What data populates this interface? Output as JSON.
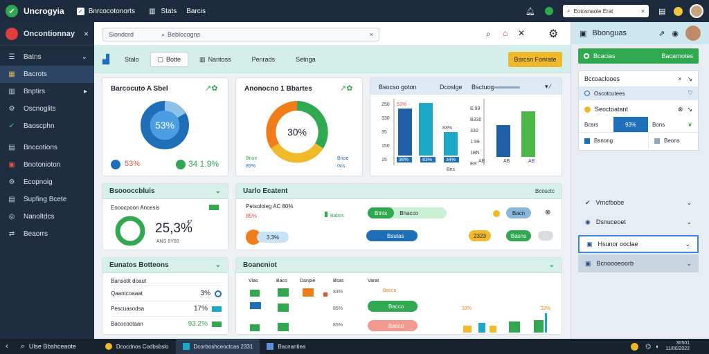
{
  "app": {
    "title": "Uncrogyia",
    "menu1": "Bnrcocotonorts",
    "menu2": "Stats",
    "menu3": "Barcis",
    "search": "Eotosnaole Erat"
  },
  "sidebar": {
    "title": "Oncontionnay",
    "items": [
      {
        "label": "Batns",
        "icon": "list-icon",
        "color": "#c6d3e0"
      },
      {
        "label": "Bacrots",
        "icon": "folder-icon",
        "color": "#e8b54a"
      },
      {
        "label": "Bnptirs",
        "icon": "building-icon",
        "color": "#c6d3e0"
      },
      {
        "label": "Oscnoglits",
        "icon": "gear-icon",
        "color": "#c6d3e0"
      },
      {
        "label": "Baoscphn",
        "icon": "check-circle-icon",
        "color": "#2fa84f"
      },
      {
        "label": "Bnccotions",
        "icon": "chart-icon",
        "color": "#c6d3e0"
      },
      {
        "label": "Bnotonioton",
        "icon": "calendar-icon",
        "color": "#e2553a"
      },
      {
        "label": "Ecopnoig",
        "icon": "settings-icon",
        "color": "#c6d3e0"
      },
      {
        "label": "Supfing Bcete",
        "icon": "doc-icon",
        "color": "#c6d3e0"
      },
      {
        "label": "Nanoltdcs",
        "icon": "globe-icon",
        "color": "#c6d3e0"
      },
      {
        "label": "Beaorrs",
        "icon": "share-icon",
        "color": "#c6d3e0"
      }
    ]
  },
  "main": {
    "search_placeholder": "Siondord",
    "search_value": "Beblocogns",
    "tabs": [
      "Stalo",
      "Botte",
      "Nantoss",
      "Penrads",
      "Setnga"
    ],
    "action": "Bsrcsn Fonrate",
    "card1": {
      "title": "Barcocuto A Sbel",
      "center": "53%",
      "stat1": "53%",
      "stat2": "34 1.9%"
    },
    "card2": {
      "title": "Anonocno 1 Bbartes",
      "center": "30%",
      "leg1": "Bnoe",
      "leg1v": "85%",
      "leg2": "Bnoe",
      "leg2v": "0ns"
    },
    "card3": {
      "title": "Bsocso goton",
      "col2": "Dcoslge",
      "col3": "Bsctuog",
      "yticks1": [
        "250",
        "330",
        "35",
        "150",
        "15"
      ],
      "yticks2": [
        "E:99",
        "B330",
        "330",
        "1:99",
        "1BN",
        "ER"
      ],
      "labels1": [
        "36%",
        "83%",
        "34%"
      ],
      "bar_top": "53%",
      "bar_mid": "83%",
      "xlab1": "Bns",
      "xlabels2": [
        "AB",
        "AB",
        "AB"
      ]
    },
    "card4": {
      "title": "Bsoooccbluis",
      "sub": "Eooocpoon Ancesis",
      "value": "25,3%",
      "sup": "47",
      "foot": "ANS 8Y59"
    },
    "card5": {
      "title": "Uarlo Ecatent",
      "right": "Bcosctc",
      "sub": "Petsoloieg AC 80%",
      "subv": "85%",
      "tag": "Babos",
      "pill1": "Btnts",
      "pill2": "Bhacco",
      "pill3": "Bacn",
      "pill4": "2323",
      "pill5": "Bsutas",
      "pill6": "Basns",
      "val": "3.3%"
    },
    "card6": {
      "title": "Eunatos Botteons",
      "rows": [
        {
          "label": "Bansotit doaut",
          "value": ""
        },
        {
          "label": "Qaantcoaaat",
          "value": "3%"
        },
        {
          "label": "Pescuasodsa",
          "value": "17%"
        },
        {
          "label": "Bacocootaan",
          "value": "93.2%"
        }
      ]
    },
    "card7": {
      "title": "Boancniot",
      "cols": [
        "Vias",
        "Baco",
        "Danpie",
        "Bsas",
        "Varat"
      ],
      "bsas": [
        "83%",
        "85%",
        "85%"
      ],
      "varat": "Bacco",
      "p1": "Bacco",
      "p2": "Bacco",
      "v1": "33%",
      "v2": "33%"
    }
  },
  "right": {
    "header": "Bbonguas",
    "green": "Bcacias",
    "green2": "Bacarnotes",
    "section1": "Bccoaclooes",
    "s1row": "Oscotcutees",
    "section2": "Seoctoatant",
    "s2a": "Bcsrs",
    "s2b": "93%",
    "s2c": "Bons",
    "s2d": "Bsnong",
    "s2e": "Beons",
    "acc1": "Vrncfbobe",
    "acc2": "Dsnuceoet",
    "acc3": "Hsunor ooclae",
    "acc4": "Bcnoooeoorb"
  },
  "taskbar": {
    "item1": "Ulse Bbshceaote",
    "item2": "Dcocdnos Codbsbslo",
    "item3": "Dcorboshceoctcas 2331",
    "item4": "Bacnantiea",
    "time": "30501",
    "date": "11/00/2022"
  },
  "colors": {
    "navy": "#1d2b3e",
    "mint": "#d7f0ea",
    "blue": "#1f6fb8",
    "green": "#2fa84f",
    "orange": "#f07d1a",
    "yellow": "#f0b92a",
    "teal": "#1aa7c8"
  }
}
